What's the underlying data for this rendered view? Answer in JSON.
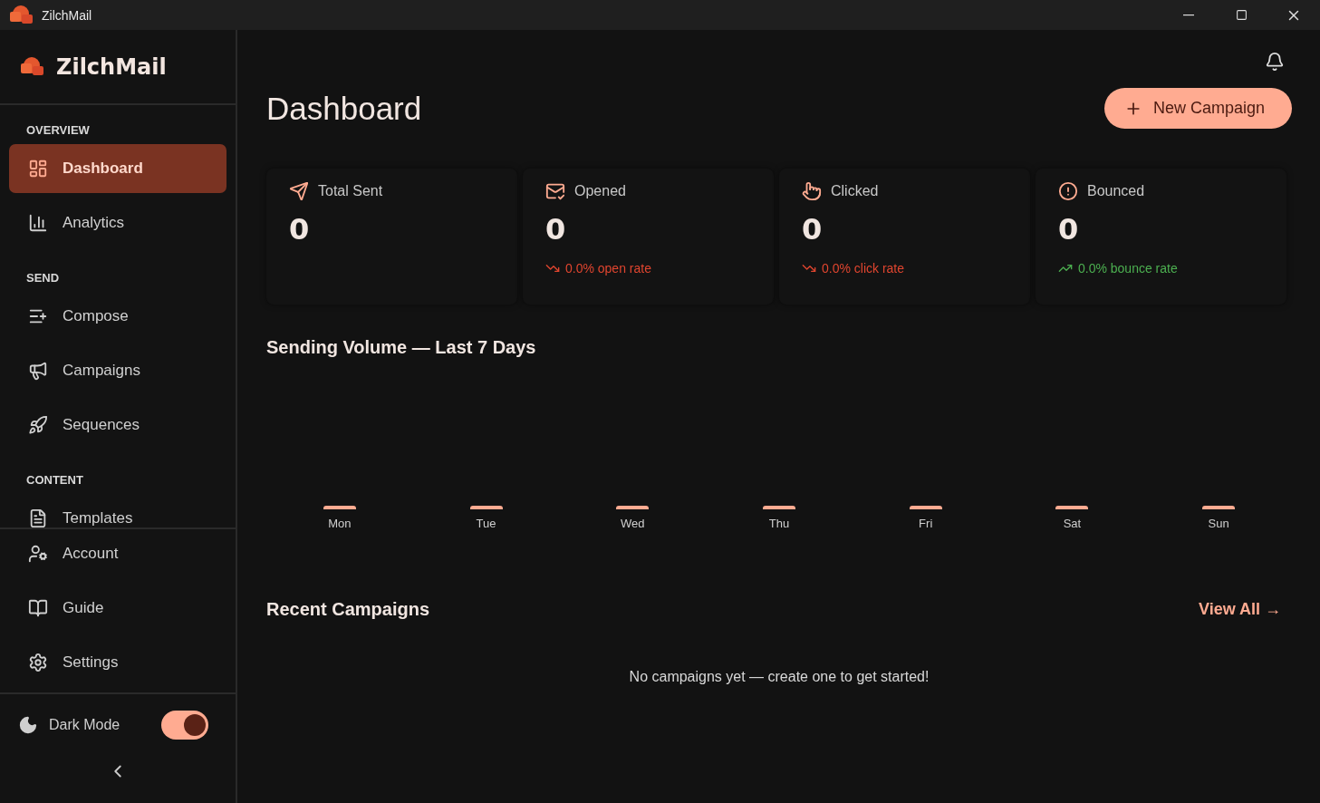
{
  "window": {
    "title": "ZilchMail"
  },
  "sidebar": {
    "brand": "ZilchMail",
    "sections": [
      {
        "heading": "OVERVIEW",
        "items": [
          {
            "label": "Dashboard",
            "selected": true
          },
          {
            "label": "Analytics",
            "selected": false
          }
        ]
      },
      {
        "heading": "SEND",
        "items": [
          {
            "label": "Compose",
            "selected": false
          },
          {
            "label": "Campaigns",
            "selected": false
          },
          {
            "label": "Sequences",
            "selected": false
          }
        ]
      },
      {
        "heading": "CONTENT",
        "items": [
          {
            "label": "Templates",
            "selected": false
          }
        ]
      }
    ],
    "footer_items": [
      {
        "label": "Account",
        "selected": false
      },
      {
        "label": "Guide",
        "selected": false
      },
      {
        "label": "Settings",
        "selected": false
      }
    ],
    "dark_mode": {
      "label": "Dark Mode",
      "on": true
    }
  },
  "header": {
    "title": "Dashboard",
    "new_button": "New Campaign"
  },
  "stats": [
    {
      "label": "Total Sent",
      "value": "0"
    },
    {
      "label": "Opened",
      "value": "0",
      "trend": {
        "kind": "down",
        "text": "0.0% open rate"
      }
    },
    {
      "label": "Clicked",
      "value": "0",
      "trend": {
        "kind": "down",
        "text": "0.0% click rate"
      }
    },
    {
      "label": "Bounced",
      "value": "0",
      "trend": {
        "kind": "up",
        "text": "0.0% bounce rate"
      }
    }
  ],
  "volume": {
    "title": "Sending Volume — Last 7 Days",
    "days": [
      "Mon",
      "Tue",
      "Wed",
      "Thu",
      "Fri",
      "Sat",
      "Sun"
    ]
  },
  "recent": {
    "title": "Recent Campaigns",
    "view_all": "View All →",
    "empty": "No campaigns yet — create one to get started!"
  }
}
